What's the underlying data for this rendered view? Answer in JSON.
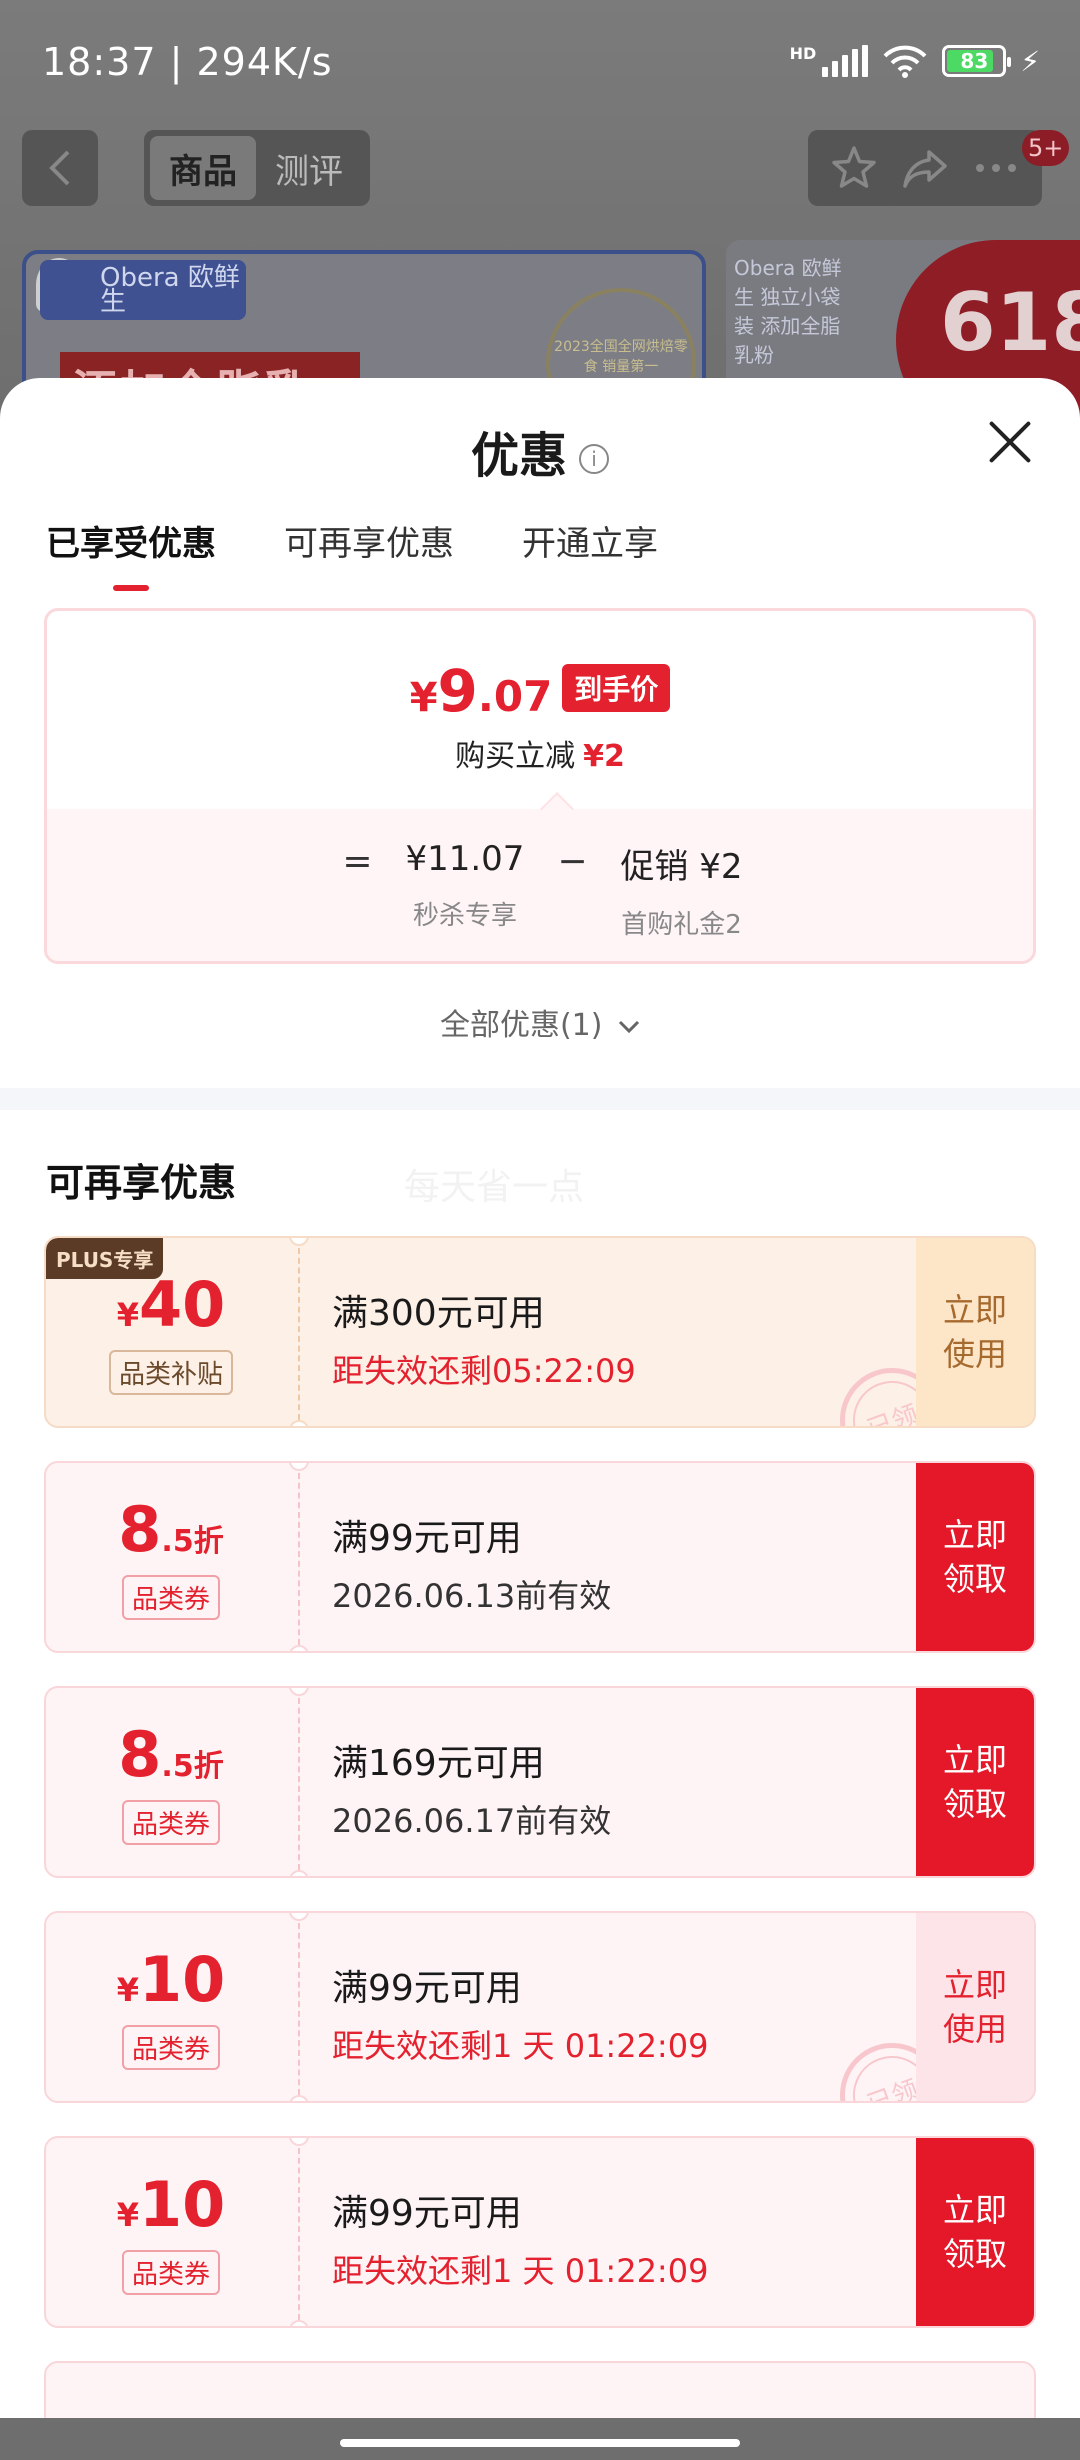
{
  "status_bar": {
    "time": "18:37 | 294K/s",
    "network": "HD",
    "battery": "83"
  },
  "nav": {
    "tabs": [
      "商品",
      "测评"
    ],
    "active_tab": 0,
    "badge": "5+"
  },
  "banner": {
    "brand": "Obera 欧鲜生",
    "headline": "添加全脂乳粉",
    "medal": "2023全国全网烘焙零食 销量第一",
    "right_brand": "Obera 欧鲜生 独立小袋装 添加全脂乳粉",
    "promo": "618"
  },
  "sheet": {
    "title": "优惠",
    "tabs": [
      "已享受优惠",
      "可再享优惠",
      "开通立享"
    ],
    "active_tab": 0
  },
  "price_card": {
    "currency": "¥",
    "price_int": "9",
    "price_dec": ".07",
    "price_tag": "到手价",
    "reduce_label": "购买立减",
    "reduce_value": "¥2",
    "op_eq": "=",
    "base_value": "¥11.07",
    "base_label": "秒杀专享",
    "op_minus": "−",
    "promo_value": "促销 ¥2",
    "promo_label": "首购礼金2"
  },
  "all_benefits": "全部优惠(1)",
  "section": {
    "title": "可再享优惠",
    "watermark": "每天省一点"
  },
  "coupons": [
    {
      "badge": "PLUS专享",
      "yen": "¥",
      "num": "40",
      "dec": "",
      "tag": "品类补贴",
      "cond": "满300元可用",
      "exp": "距失效还剩05:22:09",
      "btn1": "立即",
      "btn2": "使用",
      "stamp": "已领"
    },
    {
      "yen": "",
      "num": "8",
      "dec": ".5折",
      "tag": "品类券",
      "cond": "满99元可用",
      "exp": "2026.06.13前有效",
      "btn1": "立即",
      "btn2": "领取"
    },
    {
      "yen": "",
      "num": "8",
      "dec": ".5折",
      "tag": "品类券",
      "cond": "满169元可用",
      "exp": "2026.06.17前有效",
      "btn1": "立即",
      "btn2": "领取"
    },
    {
      "yen": "¥",
      "num": "10",
      "dec": "",
      "tag": "品类券",
      "cond": "满99元可用",
      "exp": "距失效还剩1 天 01:22:09",
      "btn1": "立即",
      "btn2": "使用",
      "stamp": "已领"
    },
    {
      "yen": "¥",
      "num": "10",
      "dec": "",
      "tag": "品类券",
      "cond": "满99元可用",
      "exp": "距失效还剩1 天 01:22:09",
      "btn1": "立即",
      "btn2": "领取"
    }
  ],
  "colors": {
    "accent_red": "#e4212e",
    "plus_brown": "#5b3b25"
  }
}
